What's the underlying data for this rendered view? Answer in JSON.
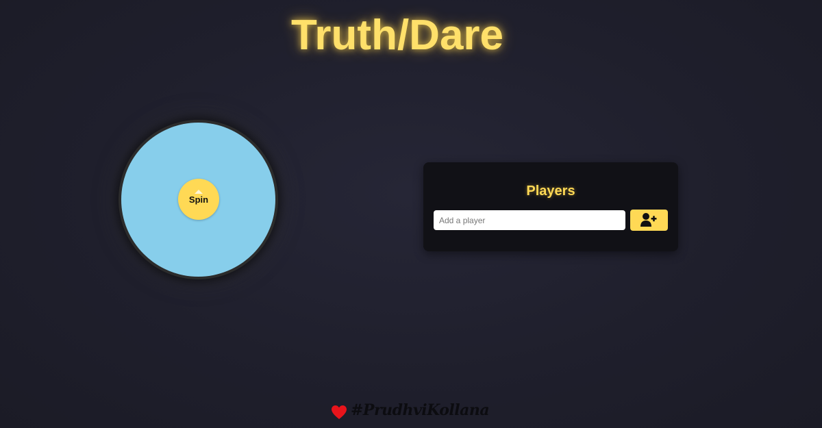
{
  "header": {
    "title": "Truth/Dare"
  },
  "wheel": {
    "spin_label": "Spin",
    "color": "#87ceeb",
    "pointer_icon": "caret-up-icon"
  },
  "players_panel": {
    "heading": "Players",
    "input_placeholder": "Add a player",
    "input_value": "",
    "add_button_icon": "user-plus-icon"
  },
  "footer": {
    "icon": "heart-icon",
    "credit": "#PrudhviKollana"
  },
  "colors": {
    "accent": "#ffd955",
    "title": "#ffe06a",
    "wheel": "#87ceeb",
    "panel": "#111116",
    "heart": "#e8141b"
  }
}
